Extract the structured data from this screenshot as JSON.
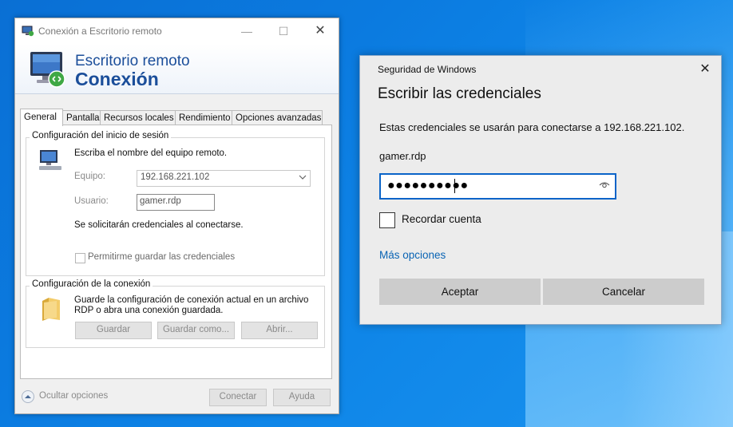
{
  "rdp_window": {
    "title": "Conexión a Escritorio remoto",
    "banner_line1": "Escritorio remoto",
    "banner_line2": "Conexión",
    "tabs": [
      "General",
      "Pantalla",
      "Recursos locales",
      "Rendimiento",
      "Opciones avanzadas"
    ],
    "logon_group": {
      "title": "Configuración del inicio de sesión",
      "instruction": "Escriba el nombre del equipo remoto.",
      "computer_label": "Equipo:",
      "computer_value": "192.168.221.102",
      "user_label": "Usuario:",
      "user_value": "gamer.rdp",
      "credentials_note": "Se solicitarán credenciales al conectarse.",
      "save_credentials_label": "Permitirme guardar las credenciales"
    },
    "connection_group": {
      "title": "Configuración de la conexión",
      "description_line1": "Guarde la configuración de conexión actual en un archivo",
      "description_line2": "RDP o abra una conexión guardada.",
      "save_button": "Guardar",
      "save_as_button": "Guardar como...",
      "open_button": "Abrir..."
    },
    "hide_options": "Ocultar opciones",
    "connect_button": "Conectar",
    "help_button": "Ayuda"
  },
  "security_dialog": {
    "title": "Seguridad de Windows",
    "heading": "Escribir las credenciales",
    "message": "Estas credenciales se usarán para conectarse a 192.168.221.102.",
    "username": "gamer.rdp",
    "password_masked": "●●●●●●●●●●",
    "remember_label": "Recordar cuenta",
    "remember_checked": false,
    "more_options": "Más opciones",
    "ok_button": "Aceptar",
    "cancel_button": "Cancelar"
  },
  "icons": {
    "rdp_app": "remote-desktop-icon",
    "computer": "computer-icon",
    "folder": "folder-icon",
    "reveal_password": "eye-icon"
  },
  "colors": {
    "desktop_blue": "#0b7be0",
    "banner_text": "#1b4e9a",
    "link": "#0a64b4",
    "focus_border": "#0a64c8"
  }
}
